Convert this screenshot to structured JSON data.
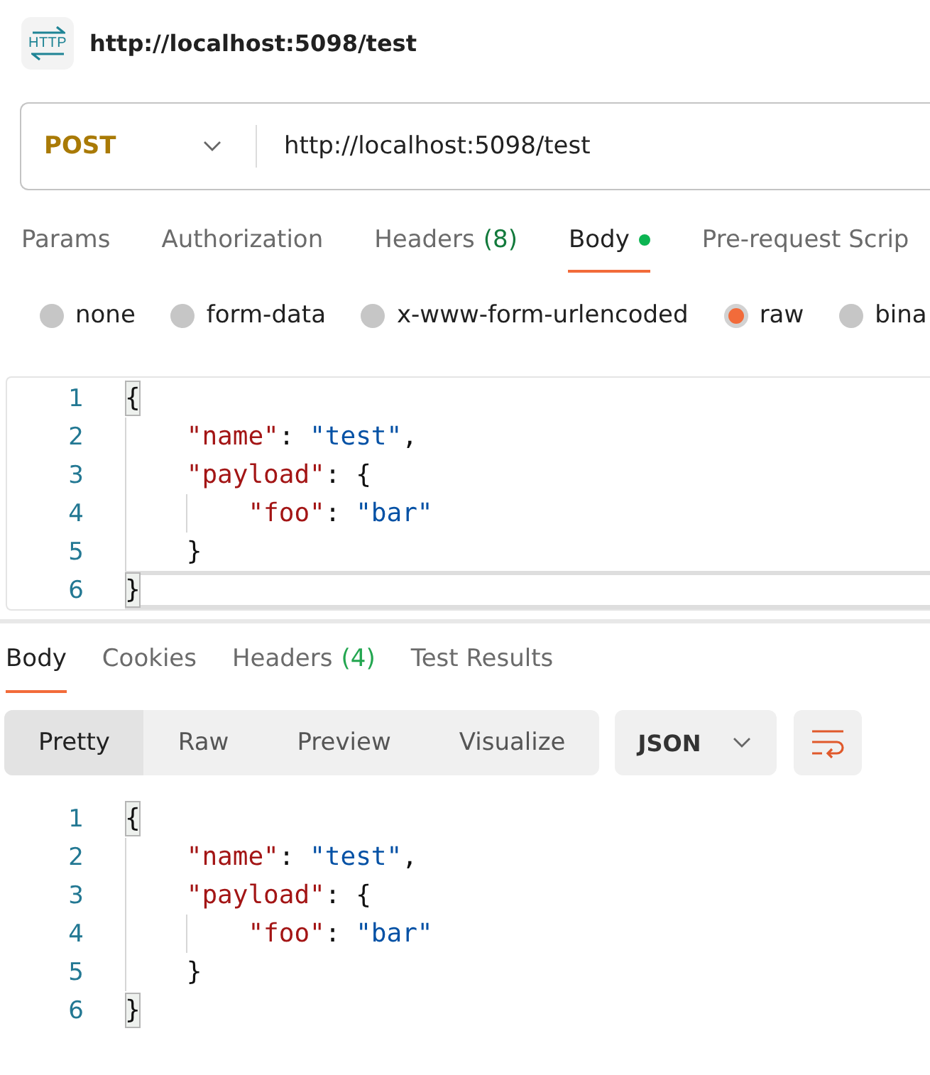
{
  "header": {
    "icon_label": "HTTP",
    "title": "http://localhost:5098/test"
  },
  "url_bar": {
    "method": "POST",
    "url": "http://localhost:5098/test"
  },
  "request_tabs": [
    {
      "label": "Params",
      "selected": false,
      "dot": false
    },
    {
      "label": "Authorization",
      "selected": false,
      "dot": false
    },
    {
      "label": "Headers",
      "count": "(8)",
      "selected": false,
      "dot": false
    },
    {
      "label": "Body",
      "selected": true,
      "dot": true
    },
    {
      "label": "Pre-request Scrip",
      "selected": false,
      "dot": false
    }
  ],
  "body_types": [
    {
      "label": "none",
      "selected": false
    },
    {
      "label": "form-data",
      "selected": false
    },
    {
      "label": "x-www-form-urlencoded",
      "selected": false
    },
    {
      "label": "raw",
      "selected": true
    },
    {
      "label": "bina",
      "selected": false
    }
  ],
  "request_editor": {
    "lines": [
      {
        "number": "1",
        "current": false,
        "tokens": [
          {
            "kind": "bracket_match",
            "text": "{"
          }
        ]
      },
      {
        "number": "2",
        "current": false,
        "tokens": [
          {
            "kind": "key",
            "text": "    \"name\""
          },
          {
            "kind": "punct",
            "text": ": "
          },
          {
            "kind": "string",
            "text": "\"test\""
          },
          {
            "kind": "punct",
            "text": ","
          }
        ]
      },
      {
        "number": "3",
        "current": false,
        "tokens": [
          {
            "kind": "key",
            "text": "    \"payload\""
          },
          {
            "kind": "punct",
            "text": ": {"
          }
        ]
      },
      {
        "number": "4",
        "current": false,
        "tokens": [
          {
            "kind": "key",
            "text": "        \"foo\""
          },
          {
            "kind": "punct",
            "text": ": "
          },
          {
            "kind": "string",
            "text": "\"bar\""
          }
        ]
      },
      {
        "number": "5",
        "current": false,
        "tokens": [
          {
            "kind": "punct",
            "text": "    }"
          }
        ]
      },
      {
        "number": "6",
        "current": true,
        "tokens": [
          {
            "kind": "bracket_match",
            "text": "}"
          }
        ]
      }
    ]
  },
  "response_tabs": [
    {
      "label": "Body",
      "selected": true
    },
    {
      "label": "Cookies",
      "selected": false
    },
    {
      "label": "Headers",
      "count": "(4)",
      "selected": false
    },
    {
      "label": "Test Results",
      "selected": false
    }
  ],
  "view_modes": [
    {
      "label": "Pretty",
      "selected": true
    },
    {
      "label": "Raw",
      "selected": false
    },
    {
      "label": "Preview",
      "selected": false
    },
    {
      "label": "Visualize",
      "selected": false
    }
  ],
  "response_format": {
    "label": "JSON"
  },
  "response_editor": {
    "lines": [
      {
        "number": "1",
        "tokens": [
          {
            "kind": "bracket_match",
            "text": "{"
          }
        ]
      },
      {
        "number": "2",
        "tokens": [
          {
            "kind": "key",
            "text": "    \"name\""
          },
          {
            "kind": "punct",
            "text": ": "
          },
          {
            "kind": "string",
            "text": "\"test\""
          },
          {
            "kind": "punct",
            "text": ","
          }
        ]
      },
      {
        "number": "3",
        "tokens": [
          {
            "kind": "key",
            "text": "    \"payload\""
          },
          {
            "kind": "punct",
            "text": ": {"
          }
        ]
      },
      {
        "number": "4",
        "tokens": [
          {
            "kind": "key",
            "text": "        \"foo\""
          },
          {
            "kind": "punct",
            "text": ": "
          },
          {
            "kind": "string",
            "text": "\"bar\""
          }
        ]
      },
      {
        "number": "5",
        "tokens": [
          {
            "kind": "punct",
            "text": "    }"
          }
        ]
      },
      {
        "number": "6",
        "tokens": [
          {
            "kind": "bracket_match",
            "text": "}"
          }
        ]
      }
    ]
  }
}
